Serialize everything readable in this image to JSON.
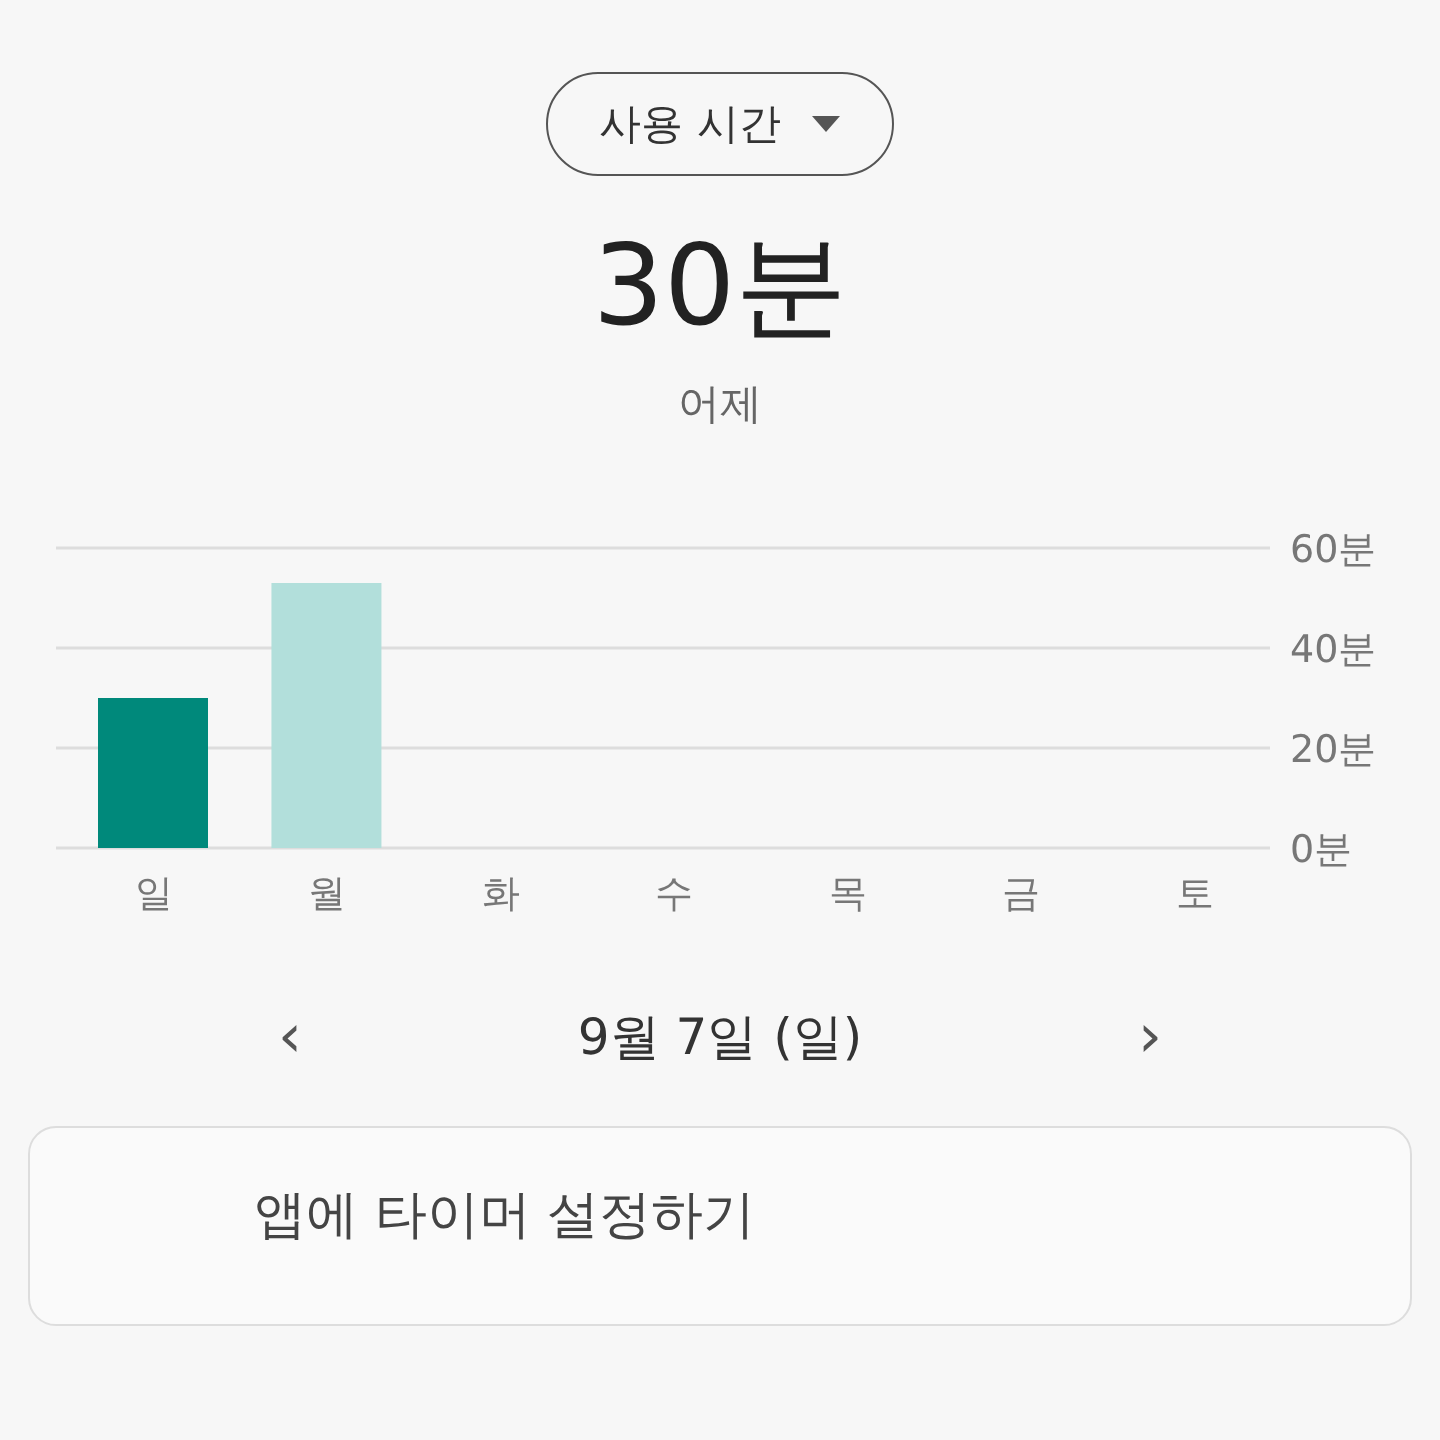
{
  "period_dropdown": {
    "label": "사용 시간"
  },
  "summary": {
    "value": "30분",
    "caption": "어제"
  },
  "chart": {
    "bars": [
      {
        "selected": true
      },
      {
        "selected": false
      }
    ],
    "chart_data": {
      "type": "bar",
      "categories": [
        "일",
        "월",
        "화",
        "수",
        "목",
        "금",
        "토"
      ],
      "ylim": [
        0,
        60
      ],
      "yticks": [
        {
          "value": 0,
          "label": "0분"
        },
        {
          "value": 20,
          "label": "20분"
        },
        {
          "value": 40,
          "label": "40분"
        },
        {
          "value": 60,
          "label": "60분"
        }
      ],
      "values": [
        30,
        53,
        null,
        null,
        null,
        null,
        null
      ]
    }
  },
  "date_nav": {
    "prev": "‹",
    "date": "9월 7일 (일)",
    "next": "›"
  },
  "card": {
    "title": "앱에 타이머 설정하기"
  }
}
